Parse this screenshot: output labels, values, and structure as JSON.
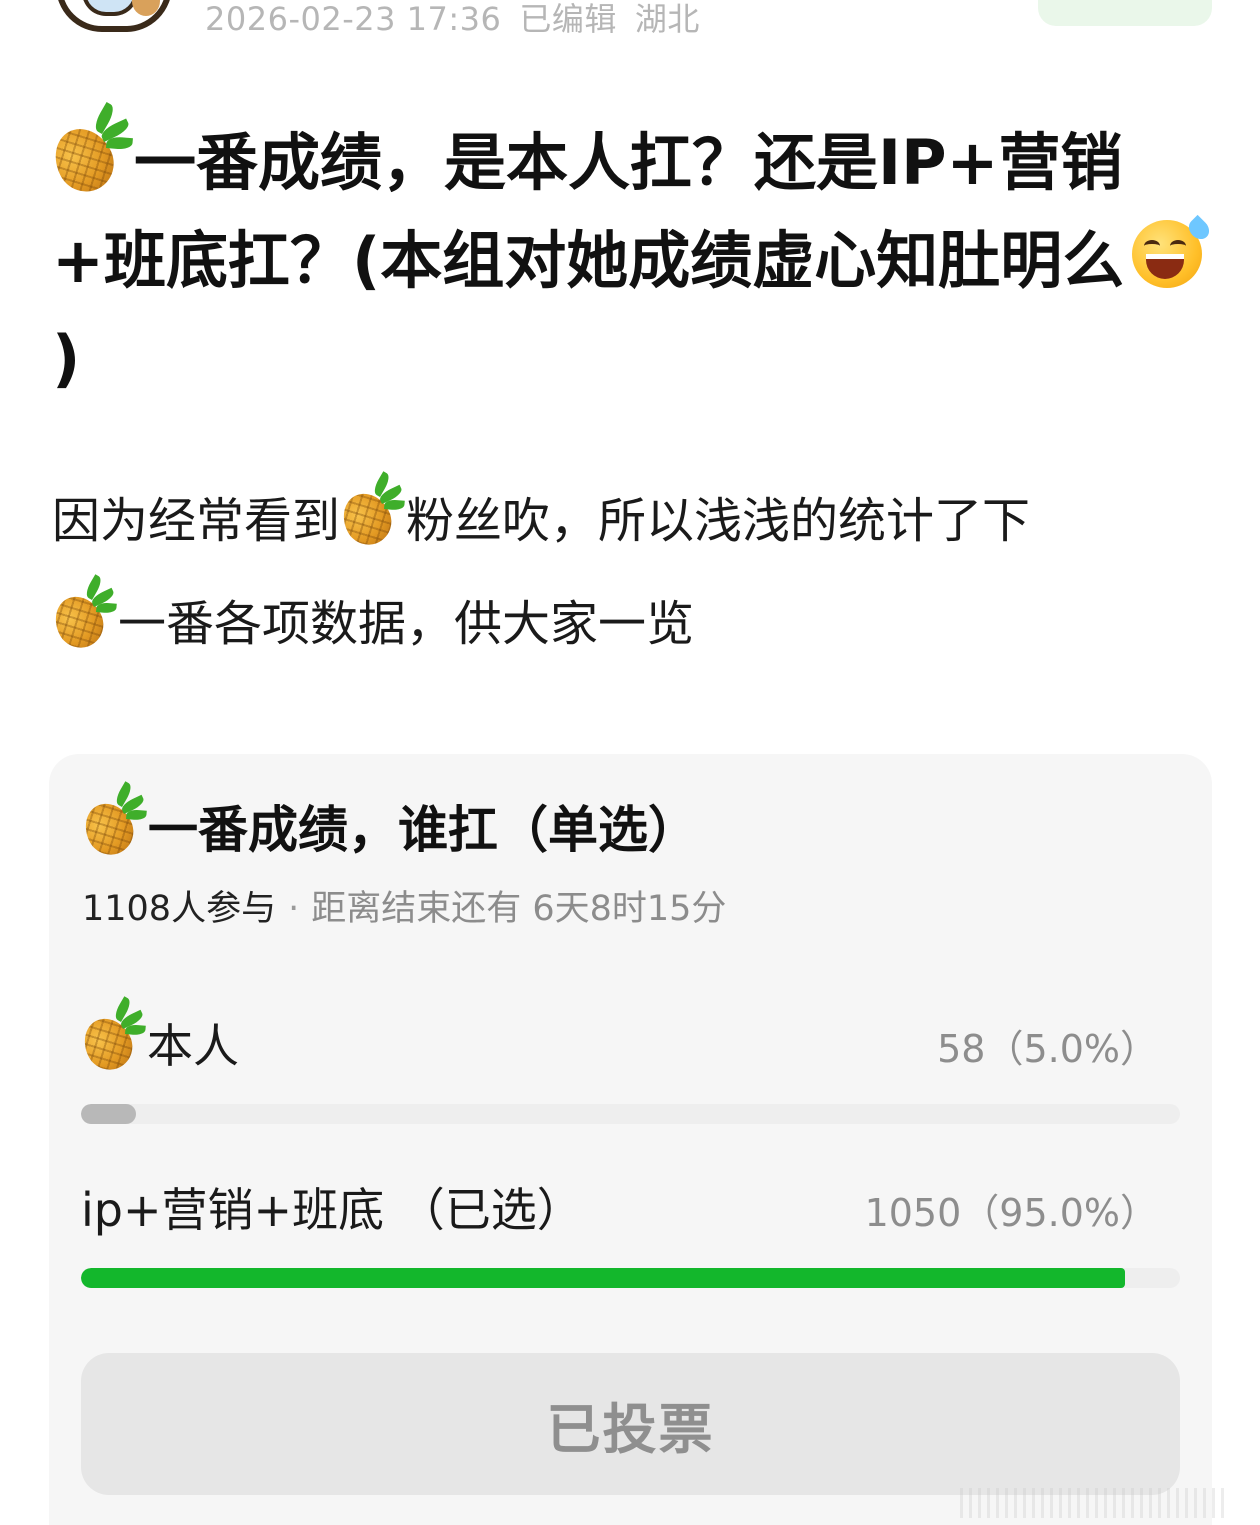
{
  "header": {
    "date": "2026-02-23 17:36",
    "edited": "已编辑",
    "location": "湖北"
  },
  "post": {
    "title_main": "一番成绩，是本人扛？还是IP+营销+班底扛？(本组对她成绩虚心知肚明么",
    "title_tail": ")",
    "body_part1": "因为经常看到",
    "body_part2": "粉丝吹，所以浅浅的统计了下",
    "body_part3": "一番各项数据，供大家一览"
  },
  "poll": {
    "title": "一番成绩，谁扛（单选）",
    "participants": "1108人参与",
    "separator": "·",
    "time_left": "距离结束还有 6天8时15分",
    "options": [
      {
        "label": "本人",
        "result": "58（5.0%）",
        "percent": 5.0,
        "selected": false
      },
      {
        "label": "ip+营销+班底 （已选）",
        "result": "1050（95.0%）",
        "percent": 95.0,
        "selected": true
      }
    ],
    "button_label": "已投票",
    "colors": {
      "selected_bar": "#13b72c",
      "unselected_bar": "#b8b8b8"
    }
  },
  "icons": [
    "pineapple-icon",
    "sweat-smile-icon",
    "avatar"
  ]
}
